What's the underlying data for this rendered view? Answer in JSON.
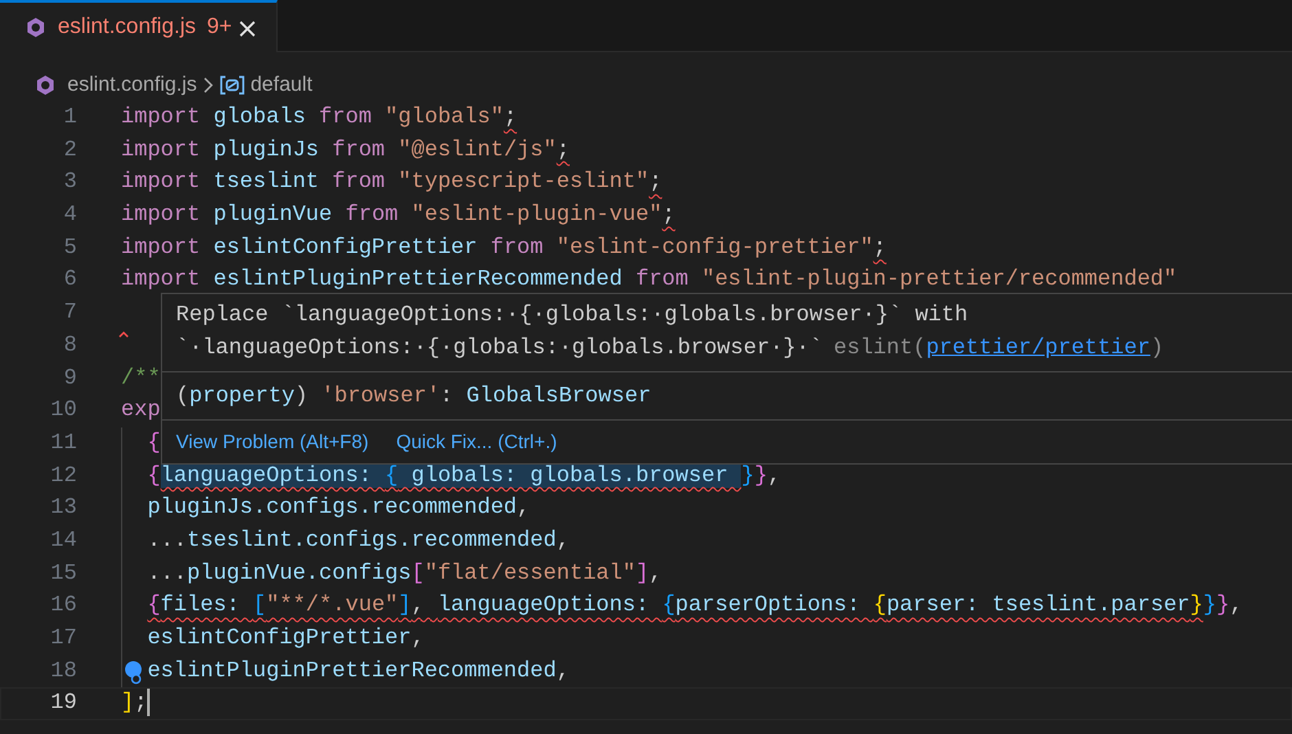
{
  "tab": {
    "title": "eslint.config.js",
    "problems": "9+",
    "selected": true,
    "error": true
  },
  "breadcrumb": [
    {
      "label": "eslint.config.js",
      "kind": "file"
    },
    {
      "label": "default",
      "kind": "variable"
    }
  ],
  "lines": [
    {
      "number": "1",
      "current": false,
      "indented": false,
      "tokens": [
        {
          "text": "import",
          "kind": "kw"
        },
        {
          "text": " globals ",
          "kind": "var"
        },
        {
          "text": "from",
          "kind": "kw"
        },
        {
          "text": " \"globals\"",
          "kind": "str"
        },
        {
          "text": ";",
          "kind": "punct",
          "error": true
        }
      ]
    },
    {
      "number": "2",
      "current": false,
      "indented": false,
      "tokens": [
        {
          "text": "import",
          "kind": "kw"
        },
        {
          "text": " pluginJs ",
          "kind": "var"
        },
        {
          "text": "from",
          "kind": "kw"
        },
        {
          "text": " \"@eslint/js\"",
          "kind": "str"
        },
        {
          "text": ";",
          "kind": "punct",
          "error": true
        }
      ]
    },
    {
      "number": "3",
      "current": false,
      "indented": false,
      "tokens": [
        {
          "text": "import",
          "kind": "kw"
        },
        {
          "text": " tseslint ",
          "kind": "var"
        },
        {
          "text": "from",
          "kind": "kw"
        },
        {
          "text": " \"typescript-eslint\"",
          "kind": "str"
        },
        {
          "text": ";",
          "kind": "punct",
          "error": true
        }
      ]
    },
    {
      "number": "4",
      "current": false,
      "indented": false,
      "tokens": [
        {
          "text": "import",
          "kind": "kw"
        },
        {
          "text": " pluginVue ",
          "kind": "var"
        },
        {
          "text": "from",
          "kind": "kw"
        },
        {
          "text": " \"eslint-plugin-vue\"",
          "kind": "str"
        },
        {
          "text": ";",
          "kind": "punct",
          "error": true
        }
      ]
    },
    {
      "number": "5",
      "current": false,
      "indented": false,
      "tokens": [
        {
          "text": "import",
          "kind": "kw"
        },
        {
          "text": " eslintConfigPrettier ",
          "kind": "var"
        },
        {
          "text": "from",
          "kind": "kw"
        },
        {
          "text": " \"eslint-config-prettier\"",
          "kind": "str"
        },
        {
          "text": ";",
          "kind": "punct",
          "error": true
        }
      ]
    },
    {
      "number": "6",
      "current": false,
      "indented": false,
      "tokens": [
        {
          "text": "import",
          "kind": "kw"
        },
        {
          "text": " eslintPluginPrettierRecommended ",
          "kind": "var"
        },
        {
          "text": "from",
          "kind": "kw"
        },
        {
          "text": " \"eslint-plugin-prettier/recommended\"",
          "kind": "str"
        }
      ]
    },
    {
      "number": "7",
      "current": false,
      "indented": false
    },
    {
      "number": "8",
      "current": false,
      "indented": false,
      "error_mark": true
    },
    {
      "number": "9",
      "current": false,
      "indented": false,
      "tokens": [
        {
          "text": "/**",
          "kind": "comment"
        }
      ]
    },
    {
      "number": "10",
      "current": false,
      "indented": false,
      "tokens": [
        {
          "text": "exp",
          "kind": "kw"
        }
      ]
    },
    {
      "number": "11",
      "current": false,
      "indented": true,
      "tokens": [
        {
          "text": "{",
          "kind": "b2"
        }
      ]
    },
    {
      "number": "12",
      "current": false,
      "indented": true,
      "tokens": [
        {
          "text": "{",
          "kind": "b2"
        },
        {
          "text": "languageOptions: ",
          "kind": "prop",
          "error": true,
          "highlight": true
        },
        {
          "text": "{",
          "kind": "b3",
          "error": true,
          "highlight": true
        },
        {
          "text": " globals: globals.browser ",
          "kind": "var",
          "error": true,
          "highlight": true
        },
        {
          "text": "}",
          "kind": "b3"
        },
        {
          "text": "}",
          "kind": "b2"
        },
        {
          "text": ",",
          "kind": "punct"
        }
      ]
    },
    {
      "number": "13",
      "current": false,
      "indented": true,
      "tokens": [
        {
          "text": "pluginJs.configs.recommended",
          "kind": "var"
        },
        {
          "text": ",",
          "kind": "punct"
        }
      ]
    },
    {
      "number": "14",
      "current": false,
      "indented": true,
      "tokens": [
        {
          "text": "...",
          "kind": "punct"
        },
        {
          "text": "tseslint.configs.recommended",
          "kind": "var"
        },
        {
          "text": ",",
          "kind": "punct"
        }
      ]
    },
    {
      "number": "15",
      "current": false,
      "indented": true,
      "tokens": [
        {
          "text": "...",
          "kind": "punct"
        },
        {
          "text": "pluginVue.configs",
          "kind": "var"
        },
        {
          "text": "[",
          "kind": "b2"
        },
        {
          "text": "\"flat/essential\"",
          "kind": "str"
        },
        {
          "text": "]",
          "kind": "b2"
        },
        {
          "text": ",",
          "kind": "punct"
        }
      ]
    },
    {
      "number": "16",
      "current": false,
      "indented": true,
      "tokens": [
        {
          "text": "{",
          "kind": "b2",
          "error": true
        },
        {
          "text": "files: ",
          "kind": "prop",
          "error": true
        },
        {
          "text": "[",
          "kind": "b3",
          "error": true
        },
        {
          "text": "\"**/*.vue\"",
          "kind": "str",
          "error": true
        },
        {
          "text": "]",
          "kind": "b3",
          "error": true
        },
        {
          "text": ", ",
          "kind": "punct",
          "error": true
        },
        {
          "text": "languageOptions: ",
          "kind": "prop",
          "error": true
        },
        {
          "text": "{",
          "kind": "b3",
          "error": true
        },
        {
          "text": "parserOptions: ",
          "kind": "prop",
          "error": true
        },
        {
          "text": "{",
          "kind": "b1",
          "error": true
        },
        {
          "text": "parser: tseslint.parser",
          "kind": "var",
          "error": true
        },
        {
          "text": "}",
          "kind": "b1",
          "error": true
        },
        {
          "text": "}",
          "kind": "b3"
        },
        {
          "text": "}",
          "kind": "b2"
        },
        {
          "text": ",",
          "kind": "punct"
        }
      ]
    },
    {
      "number": "17",
      "current": false,
      "indented": true,
      "tokens": [
        {
          "text": "eslintConfigPrettier",
          "kind": "var"
        },
        {
          "text": ",",
          "kind": "punct"
        }
      ]
    },
    {
      "number": "18",
      "current": false,
      "indented": true,
      "lightbulb": true,
      "tokens": [
        {
          "text": "eslintPluginPrettierRecommended",
          "kind": "var"
        },
        {
          "text": ",",
          "kind": "punct"
        }
      ]
    },
    {
      "number": "19",
      "current": true,
      "indented": false,
      "tokens": [
        {
          "text": "]",
          "kind": "b1"
        },
        {
          "text": ";",
          "kind": "punct"
        }
      ]
    }
  ],
  "hover": {
    "message_lines": [
      "Replace `languageOptions:·{·globals:·globals.browser·}` with",
      "`·languageOptions:·{·globals:·globals.browser·}·`"
    ],
    "source": "eslint(",
    "rule_link": "prettier/prettier",
    "source_end": ")",
    "signature": [
      {
        "text": "(",
        "kind": "punct"
      },
      {
        "text": "property",
        "kind": "var"
      },
      {
        "text": ") ",
        "kind": "punct"
      },
      {
        "text": "'browser'",
        "kind": "str"
      },
      {
        "text": ": ",
        "kind": "punct"
      },
      {
        "text": "GlobalsBrowser",
        "kind": "var"
      }
    ],
    "actions": [
      "View Problem (Alt+F8)",
      "Quick Fix... (Ctrl+.)"
    ]
  }
}
